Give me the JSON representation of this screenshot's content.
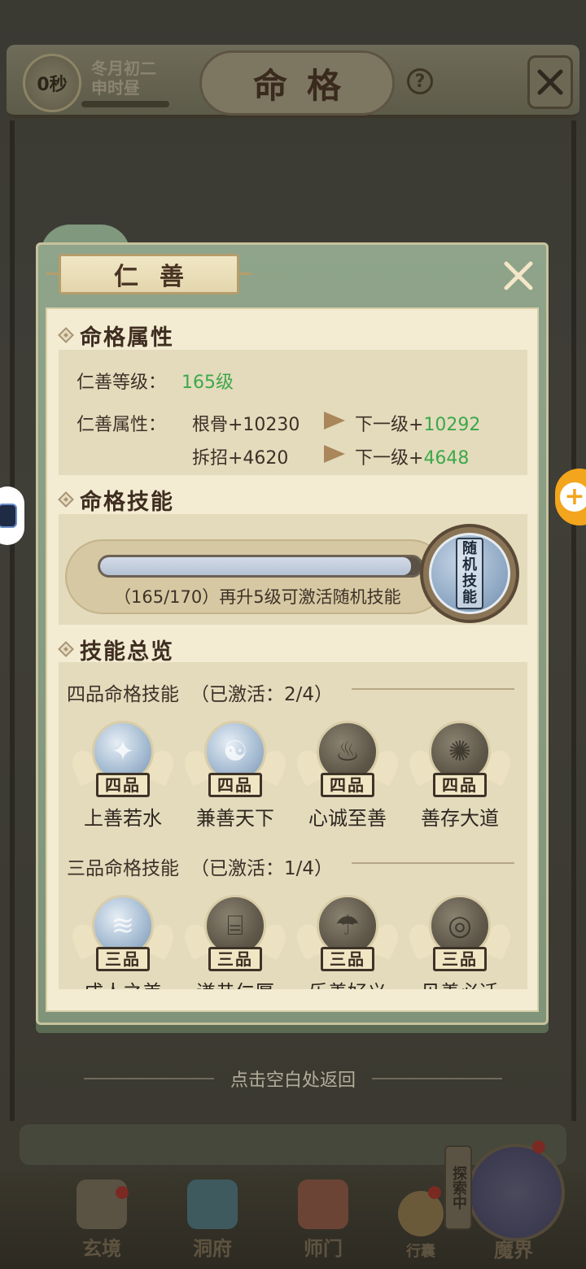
{
  "hud": {
    "timer": "0秒",
    "date_line1": "冬月初二",
    "date_line2": "申时昼",
    "title": "命格",
    "help": "?"
  },
  "modal": {
    "title": "仁善",
    "sections": {
      "attributes": "命格属性",
      "skill": "命格技能",
      "overview": "技能总览"
    },
    "attributes": {
      "level_label": "仁善等级：",
      "level_value": "165级",
      "attr_label": "仁善属性：",
      "rows": [
        {
          "current": "根骨+10230",
          "next_prefix": "下一级+",
          "next_value": "10292"
        },
        {
          "current": "拆招+4620",
          "next_prefix": "下一级+",
          "next_value": "4648"
        }
      ]
    },
    "progress": {
      "current": 165,
      "max": 170,
      "fraction": 0.97,
      "text": "（165/170）再升5级可激活随机技能",
      "orb_label": "随机技能"
    },
    "tiers": [
      {
        "title": "四品命格技能",
        "count": "（已激活：2/4）",
        "badge": "四品",
        "skills": [
          {
            "name": "上善若水",
            "active": true,
            "icon": "water-sword-icon"
          },
          {
            "name": "兼善天下",
            "active": true,
            "icon": "yin-yang-wave-icon"
          },
          {
            "name": "心诚至善",
            "active": false,
            "icon": "flame-icon"
          },
          {
            "name": "善存大道",
            "active": false,
            "icon": "swirl-icon"
          }
        ]
      },
      {
        "title": "三品命格技能",
        "count": "（已激活：1/4）",
        "badge": "三品",
        "skills": [
          {
            "name": "成人之美",
            "active": true,
            "icon": "wave-icon"
          },
          {
            "name": "谦恭仁厚",
            "active": false,
            "icon": "cauldron-icon"
          },
          {
            "name": "乐善好义",
            "active": false,
            "icon": "umbrella-icon"
          },
          {
            "name": "见善必迁",
            "active": false,
            "icon": "ring-icon"
          }
        ]
      }
    ]
  },
  "return_hint": "点击空白处返回",
  "nav": {
    "items": [
      "玄境",
      "洞府",
      "师门",
      "行囊",
      "魔界"
    ],
    "explore": "探索中"
  },
  "colors": {
    "modal_border": "#8fa48a",
    "panel_bg": "#e4dbbd",
    "highlight_green": "#3da84a",
    "progress_fill": "#b5c2d4"
  }
}
